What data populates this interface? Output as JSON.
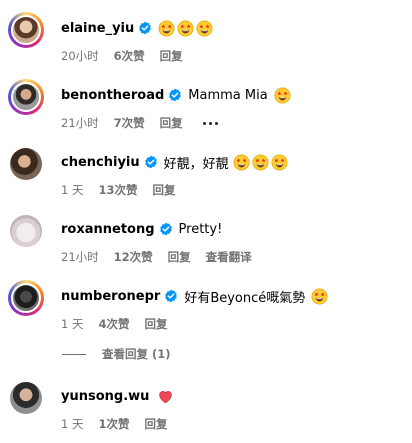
{
  "comments": [
    {
      "username": "elaine_yiu",
      "verified": true,
      "text": "",
      "emojis": [
        "star-struck-icon",
        "star-struck-icon",
        "star-struck-icon"
      ],
      "time": "20小时",
      "likes": "6次赞",
      "reply": "回复",
      "extra": ""
    },
    {
      "username": "benontheroad",
      "verified": true,
      "text": "Mamma Mia",
      "emojis": [
        "star-struck-icon"
      ],
      "time": "21小时",
      "likes": "7次赞",
      "reply": "回复",
      "extra": "more"
    },
    {
      "username": "chenchiyiu",
      "verified": true,
      "text": "好靚，好靚",
      "emojis": [
        "star-struck-icon",
        "star-struck-icon",
        "star-struck-icon"
      ],
      "time": "1 天",
      "likes": "13次赞",
      "reply": "回复",
      "extra": ""
    },
    {
      "username": "roxannetong",
      "verified": true,
      "text": "Pretty!",
      "emojis": [],
      "time": "21小时",
      "likes": "12次赞",
      "reply": "回复",
      "extra": "查看翻译"
    },
    {
      "username": "numberonepr",
      "verified": true,
      "text": "好有Beyoncé嘅氣勢",
      "emojis": [
        "star-struck-icon"
      ],
      "time": "1 天",
      "likes": "4次赞",
      "reply": "回复",
      "extra": ""
    },
    {
      "username": "yunsong.wu",
      "verified": false,
      "text": "",
      "emojis": [
        "heart-icon"
      ],
      "time": "1 天",
      "likes": "1次赞",
      "reply": "回复",
      "extra": ""
    }
  ],
  "view_replies": "查看回复 (1)",
  "colors": {
    "verified": "#0095f6",
    "meta": "#737373",
    "heart": "#ed4956"
  }
}
